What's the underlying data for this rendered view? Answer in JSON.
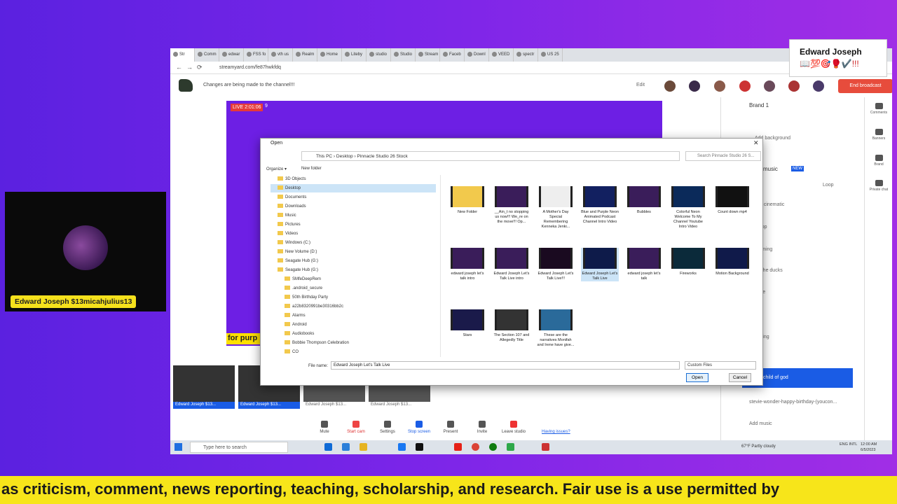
{
  "browser": {
    "tabs": [
      "Str",
      "Comm",
      "edwar",
      "FSS fo",
      "vth us",
      "Realm",
      "Home",
      "Liteby",
      "studio",
      "Studio",
      "Stream",
      "Faceb",
      "Downl",
      "VEED",
      "spectr",
      "US 25"
    ],
    "url": "streamyard.com/fe87hwkfdq"
  },
  "streamyard": {
    "header_message": "Changes are being made to the channel!!!",
    "edit_label": "Edit",
    "end_broadcast": "End broadcast",
    "live_badge": "LIVE 2:01:06",
    "viewers": "9",
    "stage_overlay_text": "for purp",
    "brand_label": "Brand 1",
    "add_background": "Add background",
    "music_label": "music",
    "new_badge": "NEW",
    "loop_label": "Loop",
    "music_items": [
      "atic cinematic",
      "e pop",
      "reaming",
      "ng the ducks",
      "pace",
      "driving"
    ],
    "selected_music": "child of god",
    "current_track": "stevie-wonder-happy-birthday-(youcon...",
    "add_music": "Add music",
    "sidebar": [
      "Comments",
      "Banners",
      "Brand",
      "Private chat"
    ],
    "thumb_labels": [
      "Edward Joseph $13...",
      "Edward Joseph $13...",
      "Edward Joseph $13...",
      "Edward Joseph $13..."
    ],
    "controls": [
      "Mute",
      "Start cam",
      "Settings",
      "Stop screen",
      "Present",
      "Invite",
      "Leave studio"
    ],
    "having_issues": "Having issues?"
  },
  "taskbar": {
    "search_placeholder": "Type here to search",
    "weather": "67°F  Partly cloudy",
    "lang": "ENG INTL",
    "time": "12:00 AM",
    "date": "6/5/2023"
  },
  "dialog": {
    "title": "Open",
    "breadcrumb": "This PC  ›  Desktop  ›  Pinnacle Studio 26 Stock",
    "search_placeholder": "Search Pinnacle Studio 26 S...",
    "organize": "Organize ▾",
    "new_folder": "New folder",
    "nav_items": [
      "3D Objects",
      "Desktop",
      "Documents",
      "Downloads",
      "Music",
      "Pictures",
      "Videos",
      "Windows (C:)",
      "New Volume (D:)",
      "Seagate Hub (G:)",
      "Seagate Hub (G:)",
      "SMfeDeepRem",
      ".android_secure",
      "50th Birthday Party",
      "a22b8320991be30316bb2c",
      "Alarms",
      "Android",
      "Audiobooks",
      "Bobbie Thompson Celebration",
      "CO"
    ],
    "files": [
      "New Folder",
      "__Ain_t no stopping us now!!! We_re on the move!!! Op...",
      "A Mother's Day Special Remembering Kenneka Jenki...",
      "Blue and Purple Neon Animated Podcast Channel Intro Video",
      "Bubbles",
      "Colorful Neon Welcome To My Channel Youtube Intro Video",
      "Count down mp4",
      "edward joseph let's talk intro",
      "Edward Joseph Let's Talk Live intro",
      "Edward Joseph Let's Talk Live!!!",
      "Edward Joseph Let's Talk Live",
      "edward joseph let's talk",
      "Fireworks",
      "Motion Background",
      "Stars",
      "The Section 107 and Allegedly Title",
      "These are the narratives Monifah and Irene have give..."
    ],
    "file_name_label": "File name:",
    "file_name_value": "Edward Joseph Let's Talk Live",
    "file_type": "Custom Files",
    "open_button": "Open",
    "cancel_button": "Cancel"
  },
  "camera": {
    "name": "Edward Joseph $13micahjulius13"
  },
  "comment": {
    "name": "Edward Joseph",
    "emoji": "📖💯🎯🥊✔️!!!"
  },
  "ticker": "as criticism, comment, news reporting, teaching, scholarship, and research. Fair use is a use permitted by"
}
